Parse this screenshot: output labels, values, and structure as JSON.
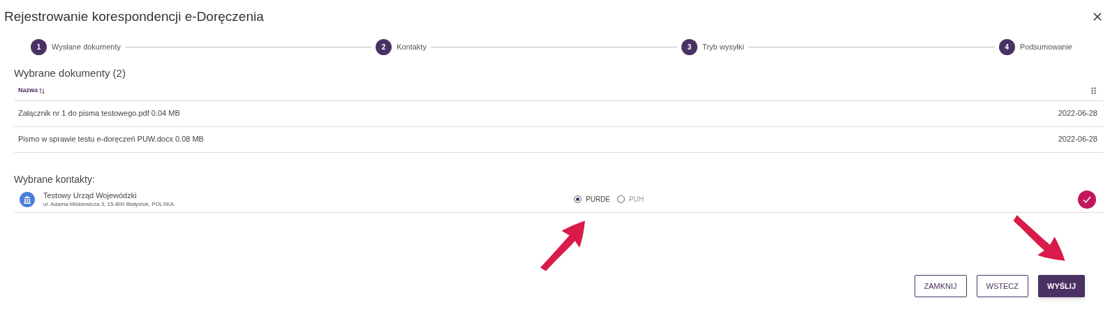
{
  "window": {
    "title": "Rejestrowanie korespondencji e-Doręczenia"
  },
  "steps": [
    {
      "number": "1",
      "label": "Wysłane dokumenty"
    },
    {
      "number": "2",
      "label": "Kontakty"
    },
    {
      "number": "3",
      "label": "Tryb wysyłki"
    },
    {
      "number": "4",
      "label": "Podsumowanie"
    }
  ],
  "documents": {
    "heading": "Wybrane dokumenty (2)",
    "column": "Nazwa",
    "rows": [
      {
        "name": "Załącznik nr 1 do pisma testowego.pdf 0.04 MB",
        "date": "2022-06-28"
      },
      {
        "name": "Pismo w sprawie testu e-doręczeń PUW.docx 0.08 MB",
        "date": "2022-06-28"
      }
    ]
  },
  "contacts": {
    "heading": "Wybrane kontakty:",
    "items": [
      {
        "name": "Testowy Urząd Wojewódzki",
        "address": "ul. Adama Mickiewicza 3, 15-800 Białystok, POLSKA",
        "checked": true,
        "options": [
          {
            "label": "PURDE",
            "selected": true
          },
          {
            "label": "PUH",
            "selected": false
          }
        ]
      }
    ]
  },
  "buttons": [
    {
      "label": "ZAMKNIJ",
      "kind": "outline"
    },
    {
      "label": "WSTECZ",
      "kind": "outline"
    },
    {
      "label": "WYŚLIJ",
      "kind": "primary"
    }
  ]
}
